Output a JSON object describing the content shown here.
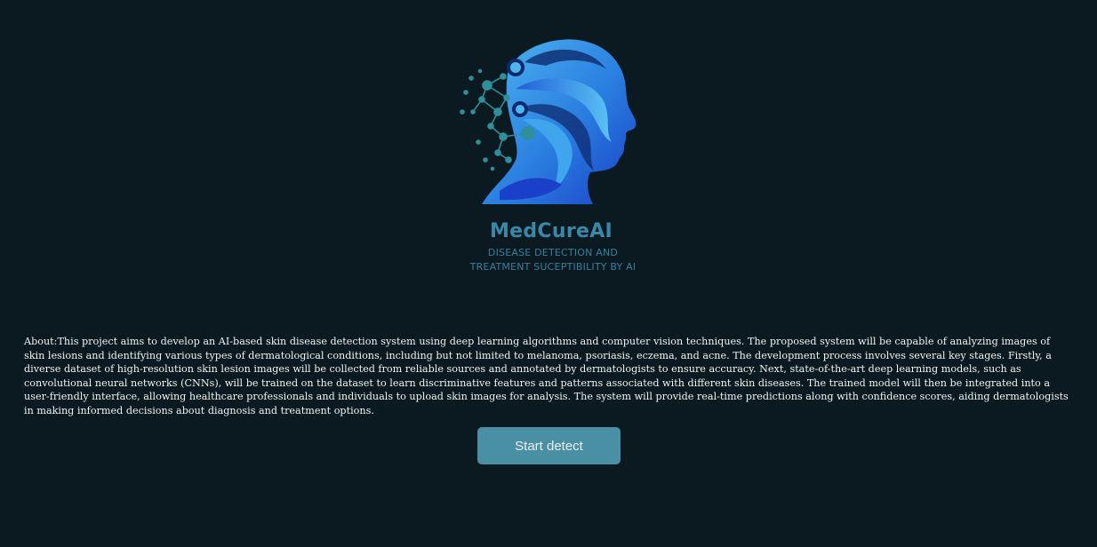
{
  "brand": {
    "name": "MedCureAI",
    "tagline_line1": "DISEASE DETECTION AND",
    "tagline_line2": "TREATMENT SUCEPTIBILITY BY AI",
    "logo_icon": "ai-head-network-logo",
    "colors": {
      "name": "#3a87a8",
      "tagline": "#3a7f9e",
      "logo_blue": "#2a7ee0",
      "logo_light": "#4fb6f0",
      "network": "#2f8f9b"
    }
  },
  "about": {
    "text": "About:This project aims to develop an AI-based skin disease detection system using deep learning algorithms and computer vision techniques. The proposed system will be capable of analyzing images of skin lesions and identifying various types of dermatological conditions, including but not limited to melanoma, psoriasis, eczema, and acne. The development process involves several key stages. Firstly, a diverse dataset of high-resolution skin lesion images will be collected from reliable sources and annotated by dermatologists to ensure accuracy. Next, state-of-the-art deep learning models, such as convolutional neural networks (CNNs), will be trained on the dataset to learn discriminative features and patterns associated with different skin diseases. The trained model will then be integrated into a user-friendly interface, allowing healthcare professionals and individuals to upload skin images for analysis. The system will provide real-time predictions along with confidence scores, aiding dermatologists in making informed decisions about diagnosis and treatment options."
  },
  "actions": {
    "start_label": "Start detect"
  },
  "theme": {
    "background": "#0a1a20",
    "button": "#4a90a4",
    "text": "#f2f2f2"
  }
}
